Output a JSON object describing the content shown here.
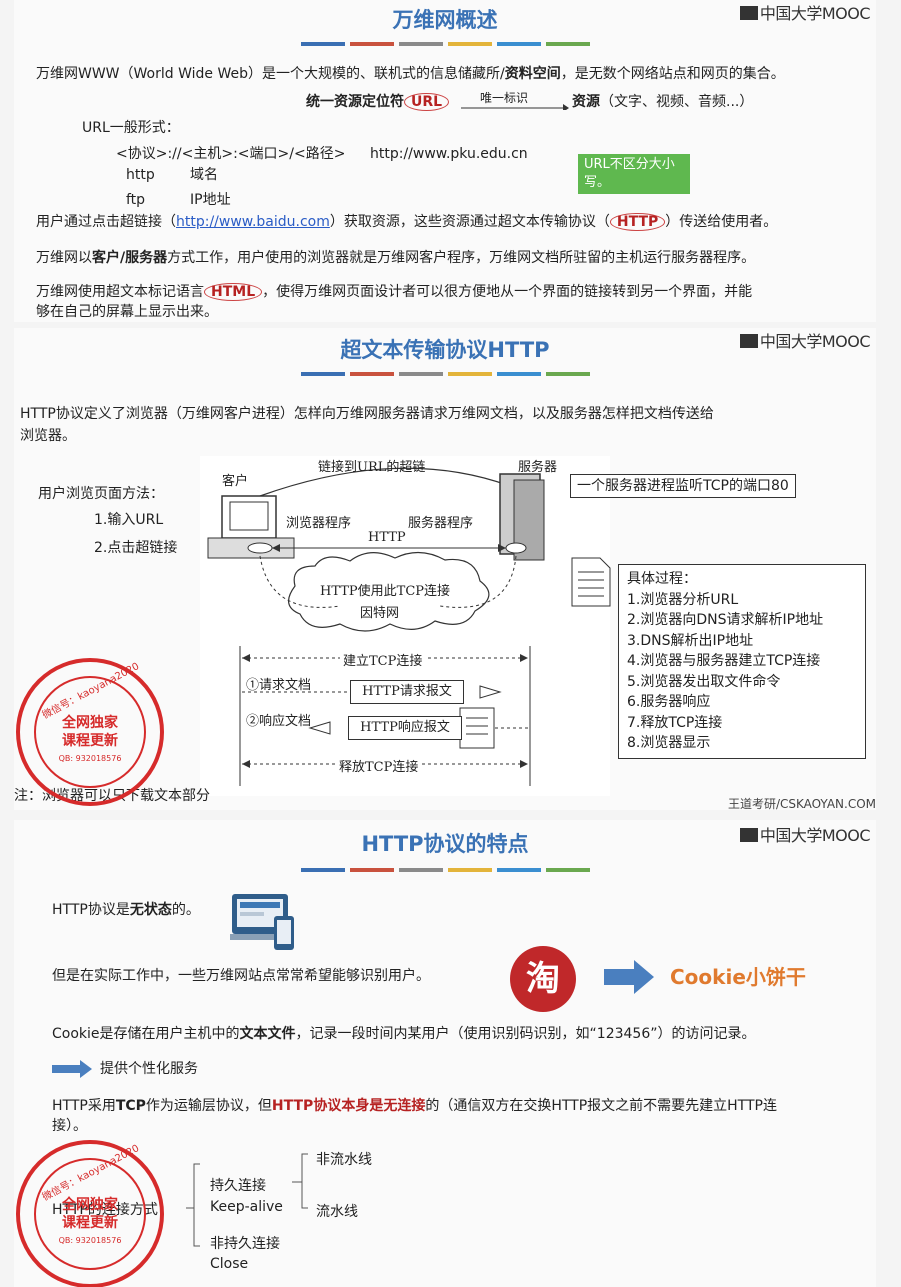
{
  "s1": {
    "title": "万维网概述",
    "mooc": "中国大学MOOC",
    "bar_colors": [
      "#3a6fb3",
      "#c9523e",
      "#8a8a8a",
      "#e3b43a",
      "#3a8ed0",
      "#6aa84f"
    ],
    "p1a": "万维网WWW（World Wide Web）是一个大规模的、联机式的信息储藏所/",
    "p1b": "资料空间",
    "p1c": "，是无数个网络站点和网页的集合。",
    "url_label": "统一资源定位符",
    "url": "URL",
    "unique": "唯一标识",
    "resource": "资源",
    "resource_types": "（文字、视频、音频...）",
    "url_form": "URL一般形式：",
    "url_pattern": "<协议>://<主机>:<端口>/<路径>",
    "url_example": "http://www.pku.edu.cn",
    "http": "http",
    "domain": "域名",
    "ftp": "ftp",
    "ip": "IP地址",
    "note": "URL不区分大小写。",
    "p2a": "用户通过点击超链接（",
    "p2link": "http://www.baidu.com",
    "p2b": "）获取资源，这些资源通过超文本传输协议（",
    "p2http": "HTTP",
    "p2c": "）传送给使用者。",
    "p3a": "万维网以",
    "p3b": "客户/服务器",
    "p3c": "方式工作，用户使用的浏览器就是万维网客户程序，万维网文档所驻留的主机运行服务器程序。",
    "p4a": "万维网使用超文本标记语言",
    "p4html": "HTML",
    "p4b": "，使得万维网页面设计者可以很方便地从一个界面的链接转到另一个界面，并能",
    "p4c": "够在自己的屏幕上显示出来。"
  },
  "s2": {
    "title": "超文本传输协议HTTP",
    "mooc": "中国大学MOOC",
    "p1": "HTTP协议定义了浏览器（万维网客户进程）怎样向万维网服务器请求万维网文档，以及服务器怎样把文档传送给",
    "p1b": "浏览器。",
    "method": "用户浏览页面方法：",
    "m1": "1.输入URL",
    "m2": "2.点击超链接",
    "client": "客户",
    "hyperlink": "链接到URL的超链",
    "server": "服务器",
    "browser": "浏览器程序",
    "server_prog": "服务器程序",
    "http": "HTTP",
    "http_tcp": "HTTP使用此TCP连接",
    "internet": "因特网",
    "port_note": "一个服务器进程监听TCP的端口80",
    "establish": "建立TCP连接",
    "req_doc": "①请求文档",
    "http_req": "HTTP请求报文",
    "resp_doc": "②响应文档",
    "http_resp": "HTTP响应报文",
    "release": "释放TCP连接",
    "steps_title": "具体过程：",
    "steps": [
      "1.浏览器分析URL",
      "2.浏览器向DNS请求解析IP地址",
      "3.DNS解析出IP地址",
      "4.浏览器与服务器建立TCP连接",
      "5.浏览器发出取文件命令",
      "6.服务器响应",
      "7.释放TCP连接",
      "8.浏览器显示"
    ],
    "bottom_note": "注：浏览器可以只下载文本部分",
    "watermark": "王道考研/CSKAOYAN.COM"
  },
  "s3": {
    "title": "HTTP协议的特点",
    "mooc": "中国大学MOOC",
    "stateless_a": "HTTP协议是",
    "stateless_b": "无状态",
    "stateless_c": "的。",
    "practice": "但是在实际工作中，一些万维网站点常常希望能够识别用户。",
    "taobao": "淘",
    "cookie_title": "Cookie小饼干",
    "cookie_a": "Cookie是存储在用户主机中的",
    "cookie_b": "文本文件",
    "cookie_c": "，记录一段时间内某用户（使用识别码识别，如“123456”）的访问记录。",
    "personal": "提供个性化服务",
    "tcp_a": "HTTP采用",
    "tcp_b": "TCP",
    "tcp_c": "作为运输层协议，但",
    "tcp_d": "HTTP协议本身是无连接",
    "tcp_e": "的（通信双方在交换HTTP报文之前不需要先建立HTTP连",
    "tcp_f": "接）。",
    "conn_mode": "HTTP的连接方式",
    "persistent": "持久连接",
    "keepalive": "Keep-alive",
    "nonpipe": "非流水线",
    "pipe": "流水线",
    "nonpersistent": "非持久连接",
    "close": "Close"
  },
  "stamp": {
    "top": "微信号：kaoyana2020",
    "l1": "全网独家",
    "l2": "课程更新",
    "qq": "QB: 932018576"
  }
}
